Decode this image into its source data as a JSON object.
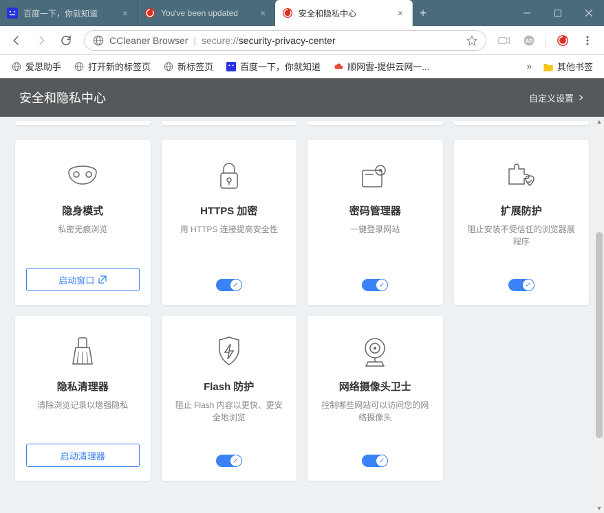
{
  "tabs": [
    {
      "title": "百度一下，你就知道",
      "favicon": "baidu"
    },
    {
      "title": "You've been updated",
      "favicon": "ccleaner"
    },
    {
      "title": "安全和隐私中心",
      "favicon": "ccleaner",
      "active": true
    }
  ],
  "window": {
    "minimize": "—",
    "maximize": "☐",
    "close": "✕",
    "newtab": "+"
  },
  "nav": {
    "brand": "CCleaner Browser",
    "url_scheme": "secure://",
    "url_path": "security-privacy-center"
  },
  "bookmarks": [
    {
      "label": "爱思助手",
      "icon": "globe"
    },
    {
      "label": "打开新的标签页",
      "icon": "globe"
    },
    {
      "label": "新标签页",
      "icon": "globe"
    },
    {
      "label": "百度一下，你就知道",
      "icon": "baidu"
    },
    {
      "label": "顺网雲-提供云网一...",
      "icon": "sw"
    }
  ],
  "bookmarks_more": "»",
  "bookmarks_folder": "其他书签",
  "page": {
    "title": "安全和隐私中心",
    "settings": "自定义设置"
  },
  "cards": [
    {
      "icon": "mask",
      "title": "隐身模式",
      "desc": "私密无痕浏览",
      "action_type": "button",
      "action_label": "启动窗口",
      "action_icon": "launch"
    },
    {
      "icon": "lock",
      "title": "HTTPS 加密",
      "desc": "用 HTTPS 连接提高安全性",
      "action_type": "toggle"
    },
    {
      "icon": "key",
      "title": "密码管理器",
      "desc": "一键登录网站",
      "action_type": "toggle"
    },
    {
      "icon": "puzzle",
      "title": "扩展防护",
      "desc": "阻止安装不受信任的浏览器展程序",
      "action_type": "toggle"
    },
    {
      "icon": "broom",
      "title": "隐私清理器",
      "desc": "清除浏览记录以增强隐私",
      "action_type": "button",
      "action_label": "启动清理器"
    },
    {
      "icon": "flash",
      "title": "Flash 防护",
      "desc": "阻止 Flash 内容以更快、更安全地浏览",
      "action_type": "toggle"
    },
    {
      "icon": "webcam",
      "title": "网络摄像头卫士",
      "desc": "控制哪些网站可以访问您的网络摄像头",
      "action_type": "toggle"
    }
  ]
}
